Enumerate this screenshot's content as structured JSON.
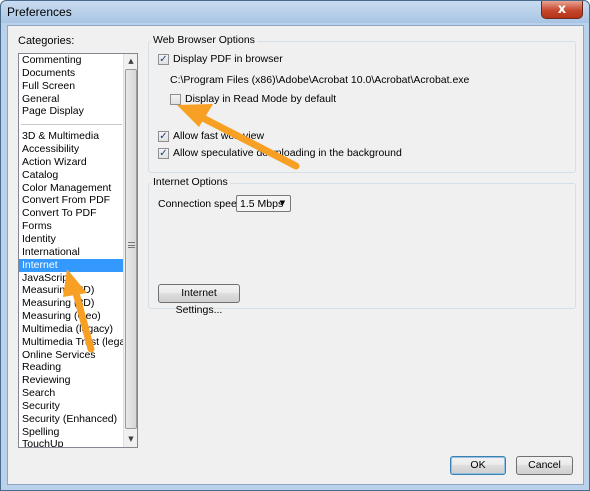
{
  "window": {
    "title": "Preferences",
    "close_glyph": "x"
  },
  "categories": {
    "label": "Categories:",
    "group1": [
      "Commenting",
      "Documents",
      "Full Screen",
      "General",
      "Page Display"
    ],
    "group2": [
      "3D & Multimedia",
      "Accessibility",
      "Action Wizard",
      "Catalog",
      "Color Management",
      "Convert From PDF",
      "Convert To PDF",
      "Forms",
      "Identity",
      "International",
      "Internet",
      "JavaScript",
      "Measuring (2D)",
      "Measuring (3D)",
      "Measuring (Geo)",
      "Multimedia (legacy)",
      "Multimedia Trust (legacy)",
      "Online Services",
      "Reading",
      "Reviewing",
      "Search",
      "Security",
      "Security (Enhanced)",
      "Spelling",
      "TouchUp"
    ],
    "selected": "Internet"
  },
  "web_browser": {
    "title": "Web Browser Options",
    "display_pdf": {
      "label": "Display PDF in browser",
      "checked": true
    },
    "path": "C:\\Program Files (x86)\\Adobe\\Acrobat 10.0\\Acrobat\\Acrobat.exe",
    "read_mode": {
      "label": "Display in Read Mode by default",
      "checked": false
    },
    "fast_web_view": {
      "label": "Allow fast web view",
      "checked": true
    },
    "speculative": {
      "label": "Allow speculative downloading in the background",
      "checked": true
    }
  },
  "internet_options": {
    "title": "Internet Options",
    "speed_label": "Connection speed:",
    "speed_value": "1.5 Mbps",
    "settings_button": "Internet Settings..."
  },
  "buttons": {
    "ok": "OK",
    "cancel": "Cancel"
  },
  "icons": {
    "check": "✓",
    "arrow_up": "▲",
    "arrow_down": "▼"
  },
  "colors": {
    "selection": "#3399ff",
    "annotation_arrow": "#f7a024"
  }
}
